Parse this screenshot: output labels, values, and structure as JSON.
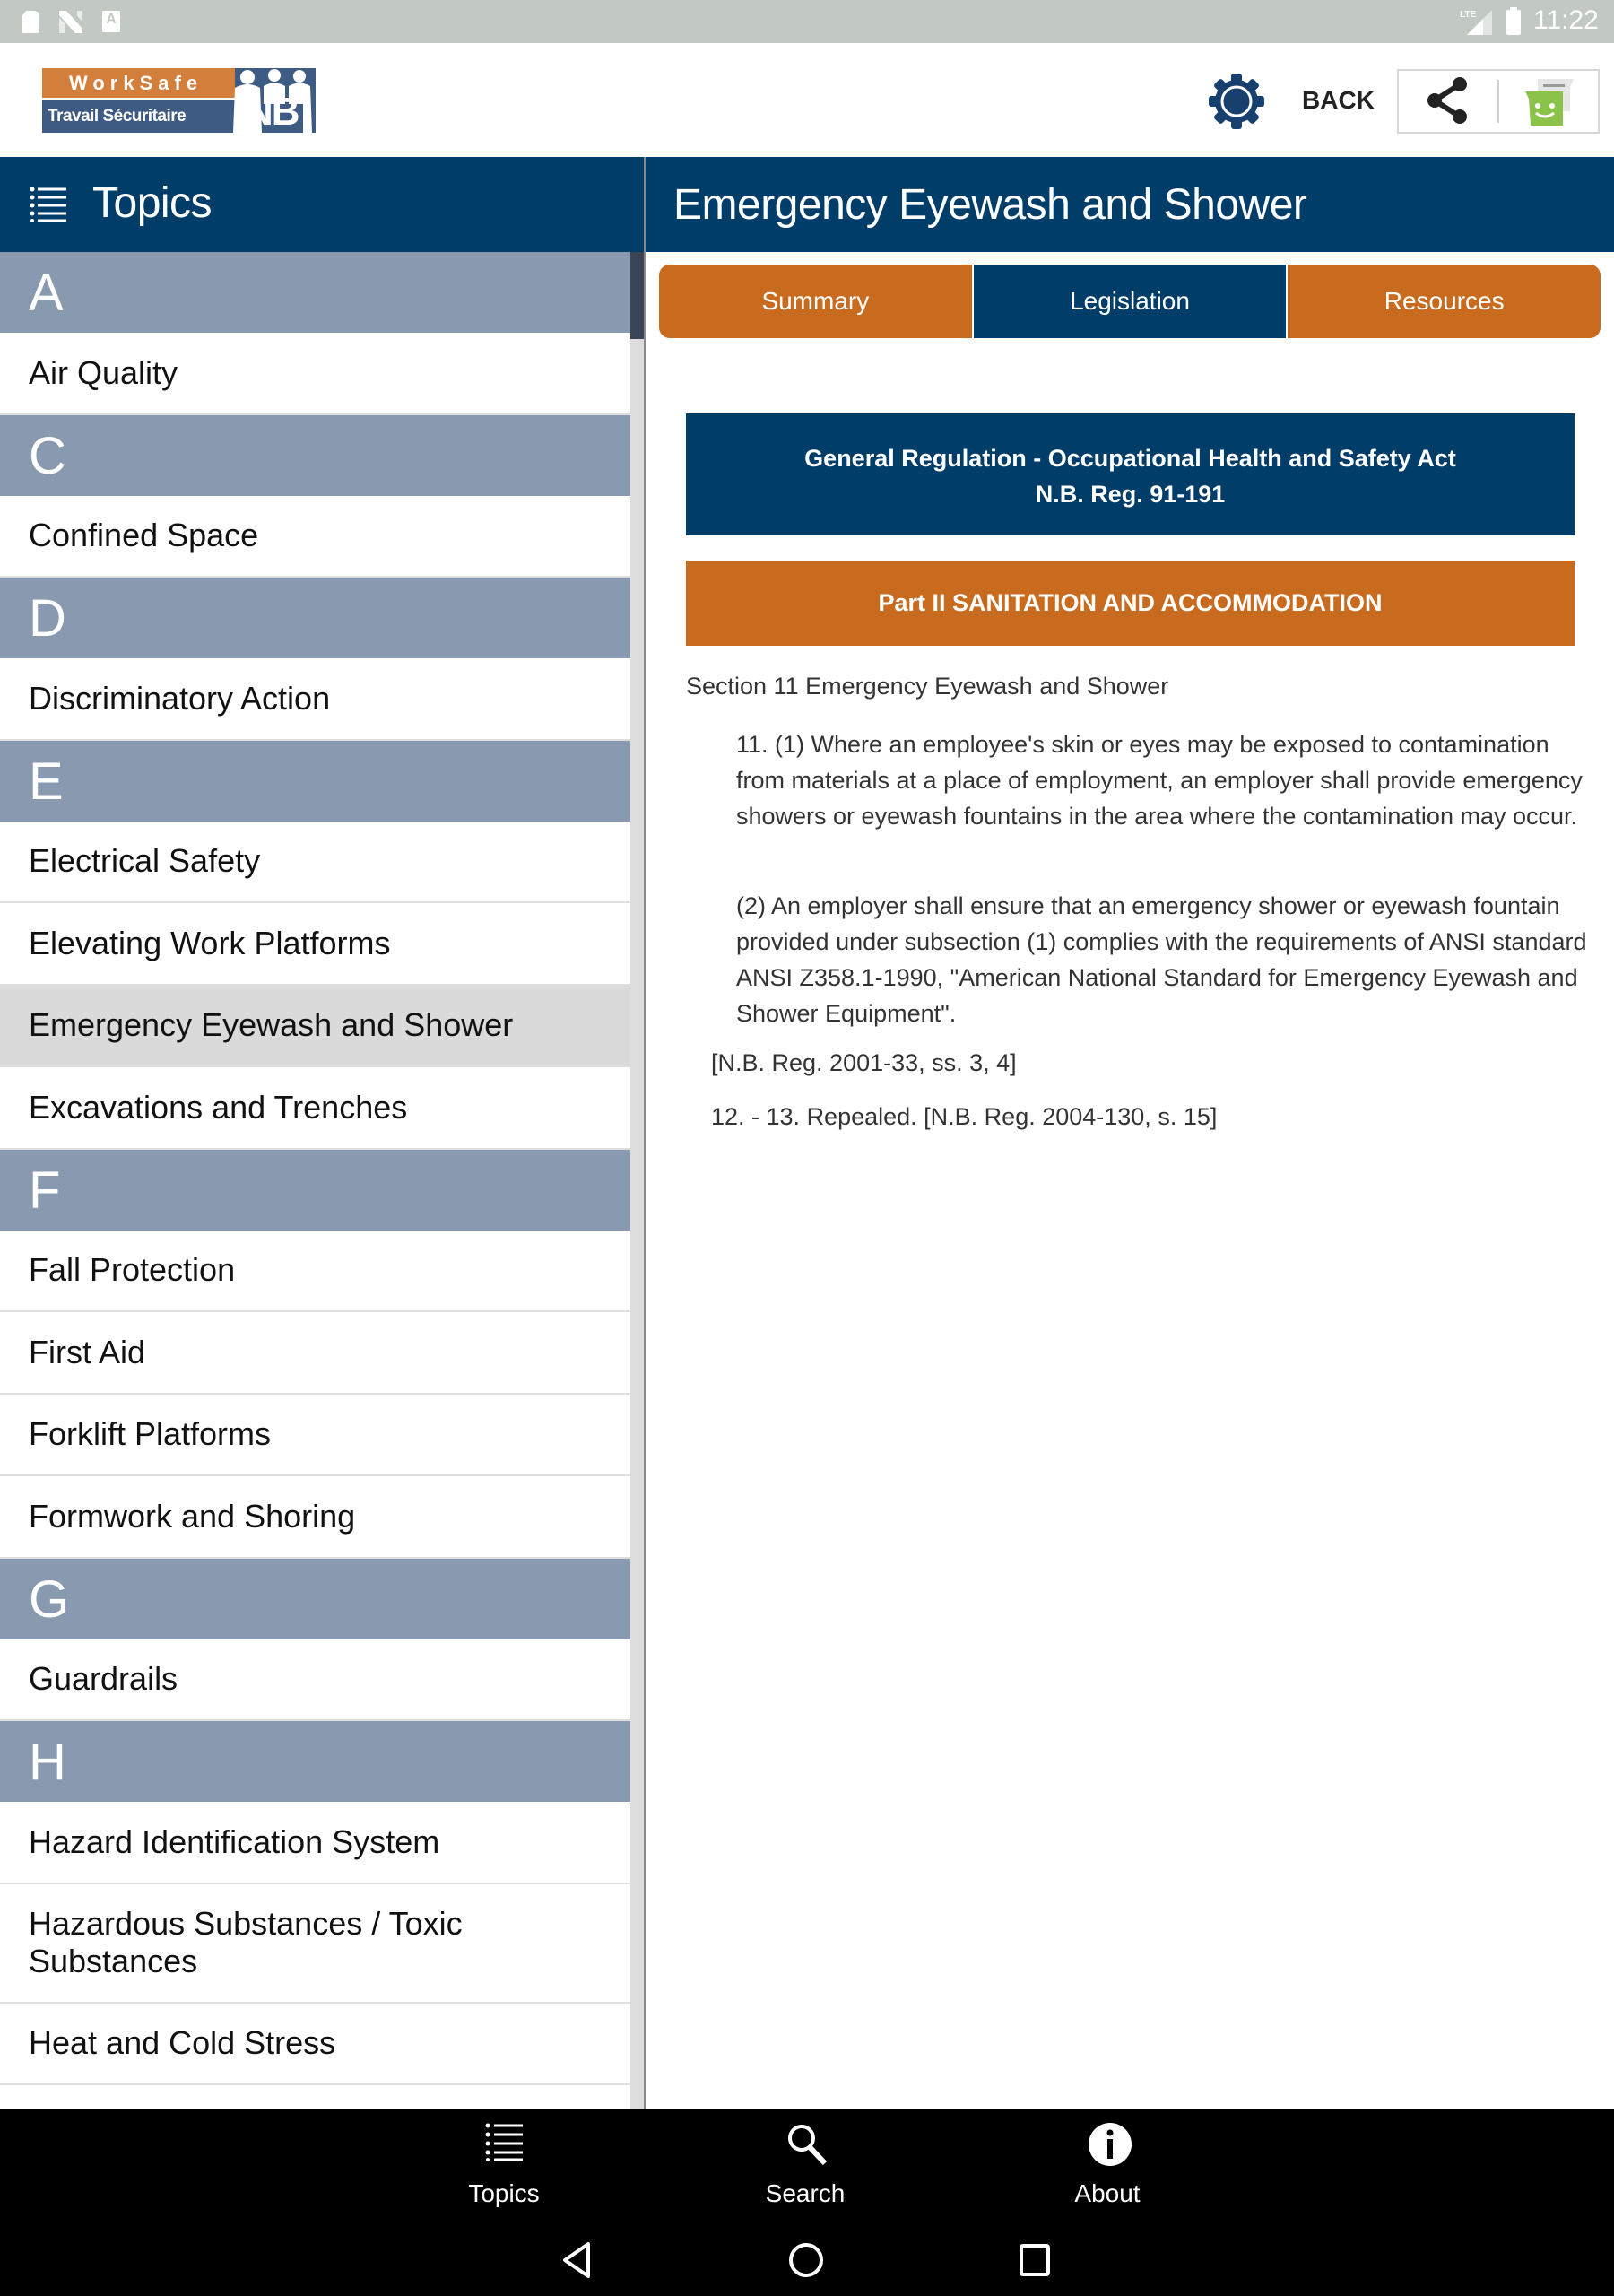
{
  "status_bar": {
    "time": "11:22",
    "left_icons": [
      "sd-card-icon",
      "n-notification-icon",
      "a-notification-icon"
    ],
    "right_icons": [
      "lte-signal-icon",
      "battery-charging-icon"
    ],
    "a_glyph": "A"
  },
  "header": {
    "logo": {
      "line1": "WorkSafe",
      "line2": "Travail Sécuritaire",
      "badge": "NB"
    },
    "settings_icon": "gear-icon",
    "back_label": "BACK",
    "share_icon": "share-icon",
    "message_icon": "sms-message-icon"
  },
  "topics_panel": {
    "title": "Topics",
    "icon": "list-icon",
    "sections": [
      {
        "letter": "A",
        "items": [
          {
            "label": "Air Quality"
          }
        ]
      },
      {
        "letter": "C",
        "items": [
          {
            "label": "Confined Space"
          }
        ]
      },
      {
        "letter": "D",
        "items": [
          {
            "label": "Discriminatory Action"
          }
        ]
      },
      {
        "letter": "E",
        "items": [
          {
            "label": "Electrical Safety"
          },
          {
            "label": "Elevating Work Platforms"
          },
          {
            "label": "Emergency Eyewash and Shower",
            "selected": true
          },
          {
            "label": "Excavations and Trenches"
          }
        ]
      },
      {
        "letter": "F",
        "items": [
          {
            "label": "Fall Protection"
          },
          {
            "label": "First Aid"
          },
          {
            "label": "Forklift Platforms"
          },
          {
            "label": "Formwork and Shoring"
          }
        ]
      },
      {
        "letter": "G",
        "items": [
          {
            "label": "Guardrails"
          }
        ]
      },
      {
        "letter": "H",
        "items": [
          {
            "label": "Hazard Identification System"
          },
          {
            "label": "Hazardous Substances / Toxic Substances"
          },
          {
            "label": "Heat and Cold Stress"
          },
          {
            "label": ""
          }
        ]
      }
    ]
  },
  "detail": {
    "title": "Emergency Eyewash and Shower",
    "tabs": [
      {
        "label": "Summary",
        "active": false
      },
      {
        "label": "Legislation",
        "active": true
      },
      {
        "label": "Resources",
        "active": false
      }
    ],
    "regulation_line1": "General Regulation - Occupational Health and Safety Act",
    "regulation_line2": "N.B. Reg. 91-191",
    "part": "Part II SANITATION AND ACCOMMODATION",
    "section_title": "Section 11 Emergency Eyewash and Shower",
    "paragraph1": "11. (1) Where an employee's skin or eyes may be exposed to contamination from materials at a place of employment, an employer shall provide emergency showers or eyewash fountains in the area where the contamination may occur.",
    "paragraph2": "(2) An employer shall ensure that an emergency shower or eyewash fountain provided under subsection (1) complies with the requirements of ANSI standard ANSI Z358.1-1990, \"American National Standard for Emergency Eyewash and Shower Equipment\".",
    "note1": "[N.B. Reg. 2001-33, ss. 3, 4]",
    "note2": "12. - 13. Repealed. [N.B. Reg. 2004-130, s. 15]"
  },
  "bottom_nav": {
    "items": [
      {
        "label": "Topics",
        "icon": "list-icon"
      },
      {
        "label": "Search",
        "icon": "search-icon"
      },
      {
        "label": "About",
        "icon": "info-icon"
      }
    ]
  },
  "system_nav": {
    "buttons": [
      "back-triangle-icon",
      "home-circle-icon",
      "recents-square-icon"
    ]
  },
  "colors": {
    "primary_blue": "#003d68",
    "accent_orange": "#c96b1e",
    "section_header": "#8899b0",
    "selected_row": "#dadada",
    "status_bar": "#c1c9c2"
  }
}
